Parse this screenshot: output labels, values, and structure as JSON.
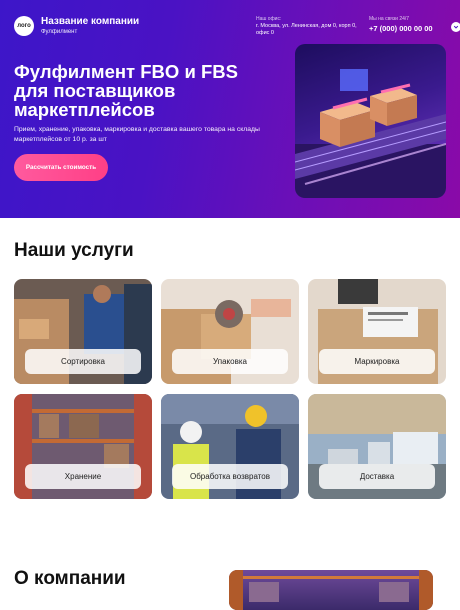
{
  "header": {
    "logo_text": "лого",
    "company_name": "Название компании",
    "company_sub": "Фулфилмент",
    "office_caption": "Наш офис:",
    "office_address": "г. Москва, ул. Ленинская, дом 0, корп 0, офис 0",
    "contact_caption": "Мы на связи 24/7",
    "phone": "+7 (000) 000 00 00"
  },
  "hero": {
    "title": "Фулфилмент FBO и FBS для поставщиков маркетплейсов",
    "description": "Прием, хранение, упаковка, маркировка и доставка вашего товара на склады маркетплейсов от 10 р. за шт",
    "cta_label": "Рассчитать стоимость"
  },
  "services": {
    "title": "Наши услуги",
    "items": [
      {
        "label": "Сортировка"
      },
      {
        "label": "Упаковка"
      },
      {
        "label": "Маркировка"
      },
      {
        "label": "Хранение"
      },
      {
        "label": "Обработка возвратов"
      },
      {
        "label": "Доставка"
      }
    ]
  },
  "about": {
    "title": "О компании"
  },
  "colors": {
    "hero_start": "#3d16c9",
    "hero_end": "#8a0aa8",
    "cta": "#ff4f93"
  }
}
